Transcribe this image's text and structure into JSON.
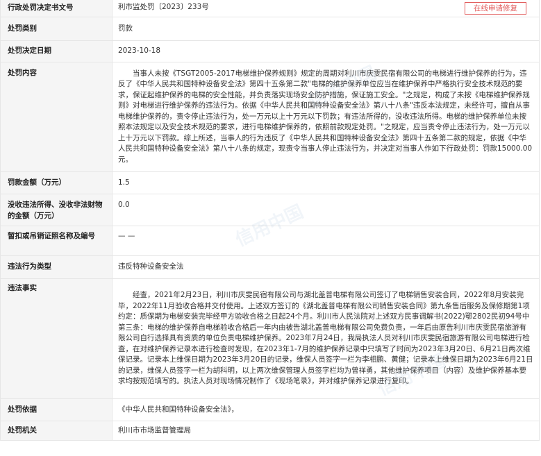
{
  "rows": {
    "doc_no": {
      "label": "行政处罚决定书文号",
      "value": "利市监处罚〔2023〕233号",
      "btn": "在线申请修复"
    },
    "category": {
      "label": "处罚类别",
      "value": "罚款"
    },
    "date": {
      "label": "处罚决定日期",
      "value": "2023-10-18"
    },
    "content": {
      "label": "处罚内容",
      "value": "当事人未按《TSGT2005-2017电梯维护保养规则》规定的周期对利川市庆雯民宿有限公司的电梯进行维护保养的行为，违反了《中华人民共和国特种设备安全法》第四十五条第二款\"电梯的维护保养单位应当在维护保养中严格执行安全技术规范的要求，保证起维护保养的电梯的安全性能，并负责落实现场安全防护措施，保证施工安全。\"之规定，构成了未按《电梯维护保养规则》对电梯进行维护保养的违法行为。依据《中华人民共和国特种设备安全法》第八十八条\"违反本法规定，未经许可，擅自从事电梯维护保养的，责令停止违法行为，处一万元以上十万元以下罚款；有违法所得的，没收违法所得。电梯的维护保养单位未按照本法规定以及安全技术规范的要求，进行电梯维护保养的，依照前款规定处罚。\"之规定，应当责令停止违法行为，处一万元以上十万元以下罚款。综上所述，当事人的行为违反了《中华人民共和国特种设备安全法》第四十五条第二款的规定，依据《中华人民共和国特种设备安全法》第八十八条的规定，现责令当事人停止违法行为，并决定对当事人作如下行政处罚：罚款15000.00元。"
    },
    "amount": {
      "label": "罚款金额（万元）",
      "value": "1.5"
    },
    "confiscate": {
      "label": "没收违法所得、没收非法财物的金额（万元）",
      "value": "0.0"
    },
    "license": {
      "label": "暂扣或吊销证照名称及编号",
      "value": "— —"
    },
    "violation_type": {
      "label": "违法行为类型",
      "value": "违反特种设备安全法"
    },
    "facts": {
      "label": "违法事实",
      "value": "经查，2021年2月23日，利川市庆雯民宿有限公司与湖北盖普电梯有限公司签订了电梯销售安装合同，2022年8月安装完毕，2022年11月验收合格并交付使用。上述双方签订的《湖北盖普电梯有限公司销售安装合同》第九条售后服务及保修期第1项约定：质保期为电梯安装完毕经甲方验收合格之日起24个月。利川市人民法院对上述双方民事调解书(2022)鄂2802民初94号中第三条：电梯的维护保养自电梯验收合格后一年内由被告湖北盖普电梯有限公司免费负责，一年后由原告利川市庆雯民宿旅游有限公司自行选择具有资质的单位负责电梯维护保养。2023年7月24日，我局执法人员对利川市庆雯民宿旅游有限公司电梯进行检查，在对维护保养记录本进行检查时发现，在2023年1-7月的维护保养记录中只填写了时间为2023年3月20日、6月21日两次维保记录。记录本上维保日期为2023年3月20日的记录，维保人员签字一栏为李相鹏、黄健；记录本上维保日期为2023年6月21日的记录，维保人员签字一栏为胡科明，以上两次维保管理人员签字栏均为曾祥勇，其他维护保养项目（内容）及维护保养基本要求均按规范填写的。执法人员对现场情况制作了《现场笔录》，并对维护保养记录进行复印。"
    },
    "basis": {
      "label": "处罚依据",
      "value": "《中华人民共和国特种设备安全法》，"
    },
    "authority": {
      "label": "处罚机关",
      "value": "利川市市场监督管理局"
    }
  },
  "watermark": "信用中国"
}
